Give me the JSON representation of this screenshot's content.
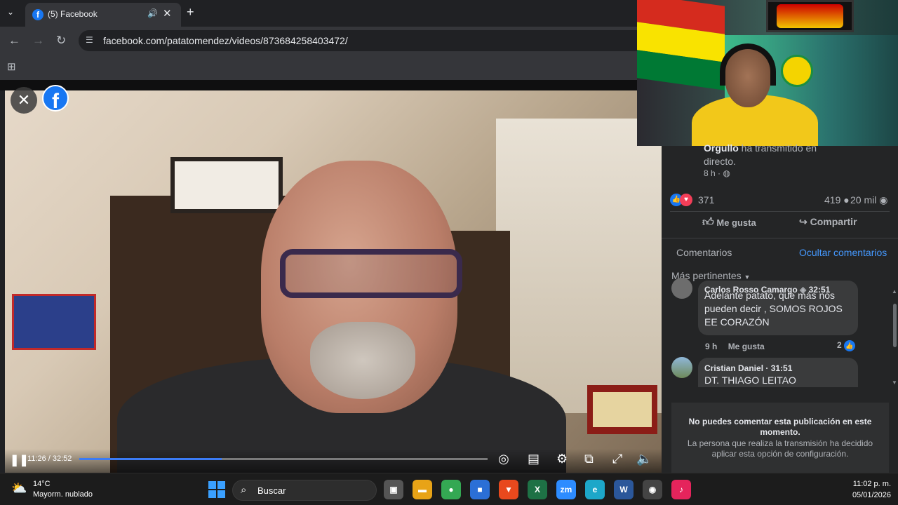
{
  "browser": {
    "tab_title": "(5) Facebook",
    "tab_favicon": "f",
    "url": "facebook.com/patatomendez/videos/873684258403472/"
  },
  "video": {
    "time": "11:26 / 32:52",
    "progress": 0.348
  },
  "panel": {
    "live_name": "Orgullo",
    "live_text": " ha transmitido en directo.",
    "live_time": "8 h · ",
    "reaction_count": "371",
    "comment_count": "419",
    "view_count": "20 mil",
    "like_label": "Me gusta",
    "share_label": "Compartir",
    "comments_tab": "Comentarios",
    "hide_comments": "Ocultar comentarios",
    "sort_label": "Más pertinentes",
    "comments": [
      {
        "author": "Carlos Rosso Camargo",
        "timestamp": "32:51",
        "text": "Adelante patato, que más nos pueden decir , SOMOS ROJOS EE CORAZÓN",
        "age": "9 h",
        "like_label": "Me gusta",
        "likes": "2"
      },
      {
        "author": "Cristian Daniel",
        "timestamp": "31:51",
        "text": "DT. THIAGO LEITAO"
      }
    ],
    "notice_title": "No puedes comentar esta publicación en este momento.",
    "notice_body": "La persona que realiza la transmisión ha decidido aplicar esta opción de configuración."
  },
  "taskbar": {
    "weather_temp": "14°C",
    "weather_desc": "Mayorm. nublado",
    "search_placeholder": "Buscar",
    "clock_time": "11:02 p. m.",
    "clock_date": "05/01/2026",
    "apps": [
      {
        "name": "task-view",
        "label": "▣",
        "color": "#555"
      },
      {
        "name": "file-explorer",
        "label": "▬",
        "color": "#e8a317"
      },
      {
        "name": "chrome",
        "label": "●",
        "color": "#34a853"
      },
      {
        "name": "microsoft-store",
        "label": "■",
        "color": "#2b6fd6"
      },
      {
        "name": "brave",
        "label": "▼",
        "color": "#e8491d"
      },
      {
        "name": "excel",
        "label": "X",
        "color": "#1e7145"
      },
      {
        "name": "zoom",
        "label": "zm",
        "color": "#2d8cff"
      },
      {
        "name": "edge",
        "label": "e",
        "color": "#1da7c9"
      },
      {
        "name": "word",
        "label": "W",
        "color": "#2b579a"
      },
      {
        "name": "obs",
        "label": "◉",
        "color": "#444"
      },
      {
        "name": "tiktok",
        "label": "♪",
        "color": "#e5245c"
      }
    ]
  }
}
